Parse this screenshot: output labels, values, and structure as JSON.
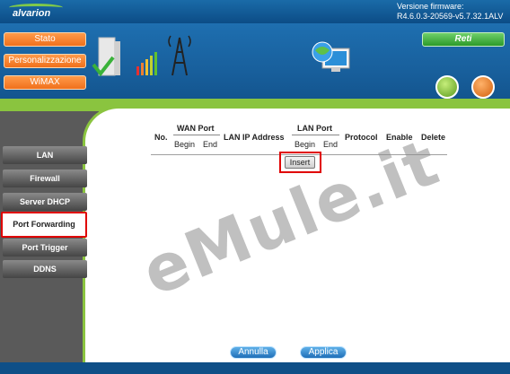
{
  "header": {
    "logo": "alvarion",
    "firmware_label": "Versione firmware:",
    "firmware_version": "R4.6.0.3-20569-v5.7.32.1ALV"
  },
  "top_menu": [
    {
      "label": "Stato"
    },
    {
      "label": "Personalizzazione"
    },
    {
      "label": "WiMAX"
    }
  ],
  "reti_label": "Reti",
  "sidebar": {
    "items": [
      {
        "label": "LAN"
      },
      {
        "label": "Firewall"
      },
      {
        "label": "Server DHCP"
      },
      {
        "label": "Port Forwarding"
      },
      {
        "label": "Port Trigger"
      },
      {
        "label": "DDNS"
      }
    ],
    "active_index": 3
  },
  "table": {
    "col_no": "No.",
    "col_wan_port": "WAN Port",
    "col_lan_ip": "LAN IP Address",
    "col_lan_port": "LAN Port",
    "col_protocol": "Protocol",
    "col_enable": "Enable",
    "col_delete": "Delete",
    "begin": "Begin",
    "end": "End"
  },
  "insert_label": "Insert",
  "footer": {
    "cancel_label": "Annulla",
    "apply_label": "Applica"
  },
  "watermark": "eMule.it",
  "colors": {
    "orange": "#f0701c",
    "green": "#8ac43f",
    "blue": "#185f9c",
    "highlight": "#e00000"
  }
}
